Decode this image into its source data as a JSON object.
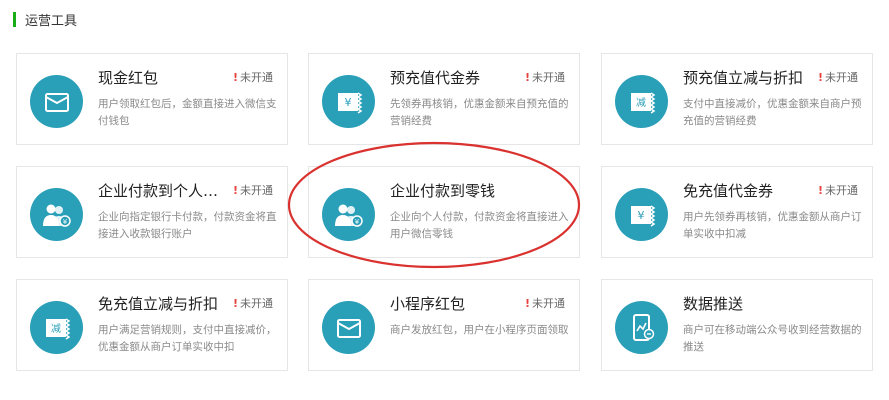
{
  "section": {
    "title": "运营工具"
  },
  "cards": [
    {
      "title": "现金红包",
      "status": "未开通",
      "desc": "用户领取红包后，金额直接进入微信支付钱包",
      "icon": "red-packet-icon"
    },
    {
      "title": "预充值代金券",
      "status": "未开通",
      "desc": "先领券再核销，优惠金额来自预充值的营销经费",
      "icon": "yuan-voucher-icon"
    },
    {
      "title": "预充值立减与折扣",
      "status": "未开通",
      "desc": "支付中直接减价，优惠金额来自商户预充值的营销经费",
      "icon": "discount-voucher-icon"
    },
    {
      "title": "企业付款到个人银…",
      "status": "未开通",
      "desc": "企业向指定银行卡付款，付款资金将直接进入收款银行账户",
      "icon": "users-payment-icon"
    },
    {
      "title": "企业付款到零钱",
      "status": "",
      "desc": "企业向个人付款，付款资金将直接进入用户微信零钱",
      "icon": "users-payment-icon"
    },
    {
      "title": "免充值代金券",
      "status": "未开通",
      "desc": "用户先领券再核销，优惠金额从商户订单实收中扣减",
      "icon": "yuan-voucher-icon"
    },
    {
      "title": "免充值立减与折扣",
      "status": "未开通",
      "desc": "用户满足营销规则，支付中直接减价，优惠金额从商户订单实收中扣",
      "icon": "discount-voucher-icon"
    },
    {
      "title": "小程序红包",
      "status": "未开通",
      "desc": "商户发放红包，用户在小程序页面领取",
      "icon": "red-packet-icon"
    },
    {
      "title": "数据推送",
      "status": "",
      "desc": "商户可在移动端公众号收到经营数据的推送",
      "icon": "mobile-data-icon"
    }
  ],
  "colors": {
    "icon_bg": "#2a9fb8",
    "accent_bar": "#1aad19",
    "status_mark": "#e64340",
    "highlight": "#d9322f"
  }
}
